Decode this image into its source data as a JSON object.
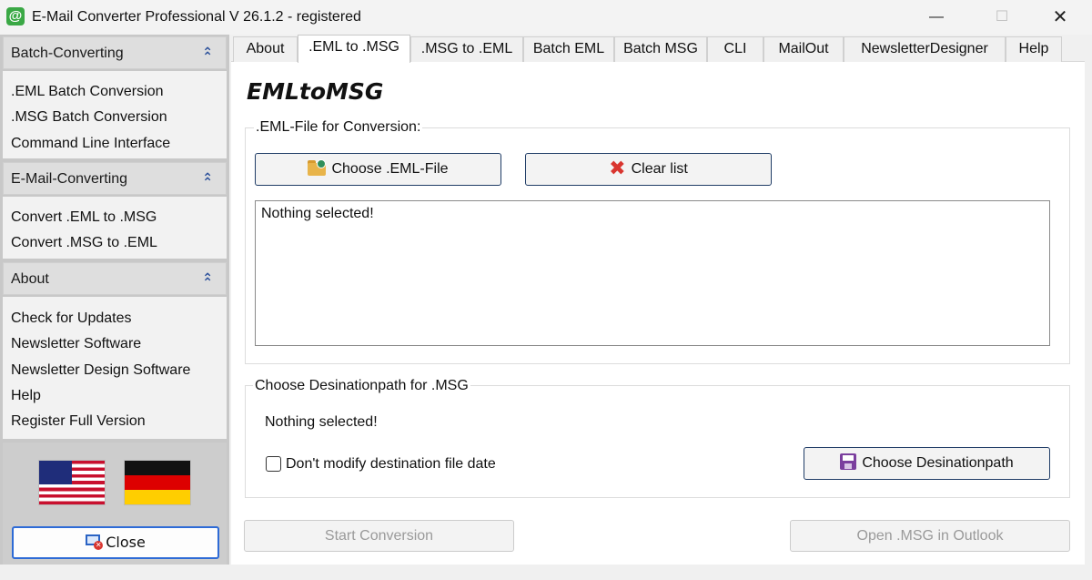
{
  "window": {
    "title": "E-Mail Converter Professional V 26.1.2 - registered",
    "min_glyph": "—",
    "max_glyph": "☐",
    "close_glyph": "✕"
  },
  "sidebar": {
    "sections": [
      {
        "header": "Batch-Converting",
        "items": [
          ".EML Batch Conversion",
          ".MSG Batch Conversion",
          "Command Line Interface"
        ]
      },
      {
        "header": "E-Mail-Converting",
        "items": [
          "Convert .EML to .MSG",
          "Convert .MSG to .EML"
        ]
      },
      {
        "header": "About",
        "items": [
          "Check for Updates",
          "Newsletter Software",
          "Newsletter Design Software",
          "Help",
          "Register Full Version"
        ]
      }
    ],
    "collapse_glyph": "⌃",
    "close_button": "Close"
  },
  "tabs": [
    {
      "label": "About"
    },
    {
      "label": ".EML to .MSG"
    },
    {
      "label": ".MSG to .EML"
    },
    {
      "label": "Batch EML"
    },
    {
      "label": "Batch MSG"
    },
    {
      "label": "CLI"
    },
    {
      "label": "MailOut"
    },
    {
      "label": "NewsletterDesigner"
    },
    {
      "label": "Help"
    }
  ],
  "active_tab": ".EML to .MSG",
  "main": {
    "heading": "EMLtoMSG",
    "file_group": {
      "legend": ".EML-File for Conversion:",
      "choose_button": "Choose .EML-File",
      "clear_button": "Clear list",
      "list_text": "Nothing selected!"
    },
    "dest_group": {
      "legend": "Choose Desinationpath for .MSG",
      "status": "Nothing selected!",
      "checkbox_label": "Don't modify destination file date",
      "checkbox_checked": false,
      "choose_button": "Choose Desinationpath"
    },
    "start_button": "Start Conversion",
    "open_button": "Open .MSG in Outlook"
  },
  "icons": {
    "app": "email-at-icon",
    "choose_file": "folder-icon",
    "clear": "red-x-icon",
    "destination": "floppy-disk-icon",
    "close": "monitor-close-icon"
  },
  "colors": {
    "accent_blue": "#2e6bd6",
    "sidebar_bg": "#c8c8c8",
    "clear_red": "#d9352f",
    "floppy_purple": "#7b3f9e"
  }
}
